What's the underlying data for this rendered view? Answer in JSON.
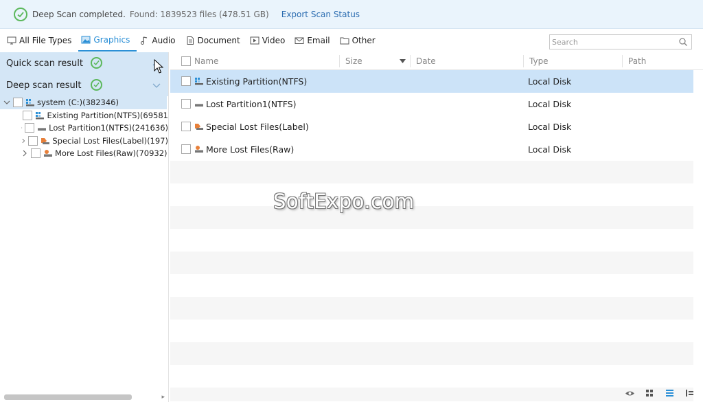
{
  "status": {
    "message": "Deep Scan completed.",
    "found": "Found: 1839523 files (478.51 GB)",
    "export_label": "Export Scan Status"
  },
  "filters": {
    "tabs": [
      {
        "label": "All File Types",
        "icon": "monitor-icon"
      },
      {
        "label": "Graphics",
        "icon": "image-icon",
        "active": true
      },
      {
        "label": "Audio",
        "icon": "music-note-icon"
      },
      {
        "label": "Document",
        "icon": "document-icon"
      },
      {
        "label": "Video",
        "icon": "video-icon"
      },
      {
        "label": "Email",
        "icon": "email-icon"
      },
      {
        "label": "Other",
        "icon": "folder-icon"
      }
    ],
    "search_placeholder": "Search"
  },
  "left": {
    "quick_label": "Quick scan result",
    "deep_label": "Deep scan result",
    "tree": {
      "root": "system (C:)(382346)",
      "children": [
        "Existing Partition(NTFS)(69581",
        "Lost Partition1(NTFS)(241636)",
        "Special Lost Files(Label)(197)",
        "More Lost Files(Raw)(70932)"
      ]
    }
  },
  "table": {
    "headers": {
      "name": "Name",
      "size": "Size",
      "date": "Date",
      "type": "Type",
      "path": "Path"
    },
    "rows": [
      {
        "name": "Existing Partition(NTFS)",
        "type": "Local Disk"
      },
      {
        "name": "Lost Partition1(NTFS)",
        "type": "Local Disk"
      },
      {
        "name": "Special Lost Files(Label)",
        "type": "Local Disk"
      },
      {
        "name": "More Lost Files(Raw)",
        "type": "Local Disk"
      }
    ]
  },
  "watermark": "SoftExpo.com",
  "colors": {
    "accent": "#2a8fd6",
    "success": "#5cb85c",
    "selection": "#cce3f8"
  }
}
